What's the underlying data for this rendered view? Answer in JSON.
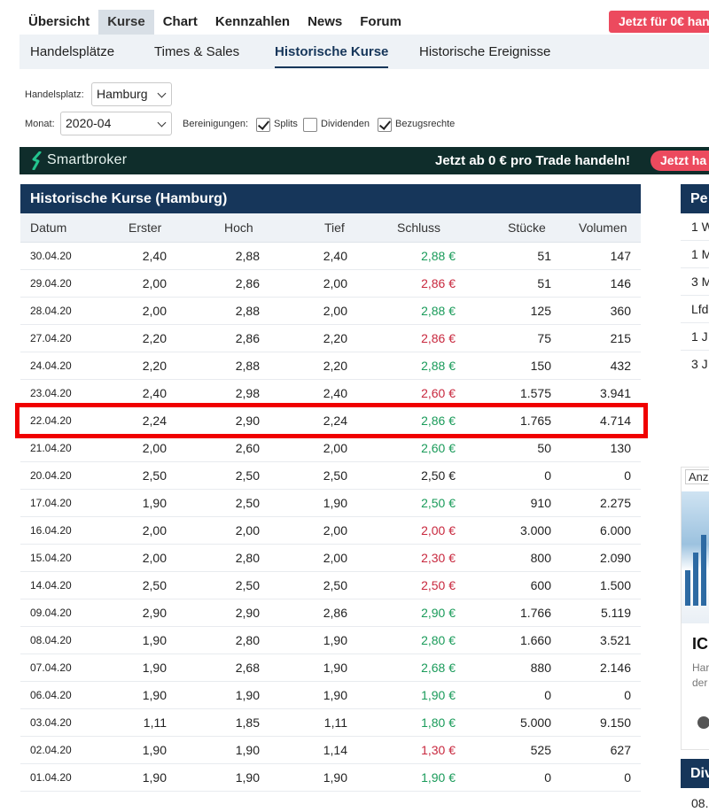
{
  "topnav": {
    "items": [
      {
        "label": "Übersicht"
      },
      {
        "label": "Kurse"
      },
      {
        "label": "Chart"
      },
      {
        "label": "Kennzahlen"
      },
      {
        "label": "News"
      },
      {
        "label": "Forum"
      }
    ],
    "active": "Kurse",
    "cta_label": "Jetzt für 0€ han"
  },
  "subnav": {
    "items": [
      {
        "label": "Handelsplätze"
      },
      {
        "label": "Times & Sales"
      },
      {
        "label": "Historische Kurse"
      },
      {
        "label": "Historische Ereignisse"
      }
    ],
    "active": "Historische Kurse"
  },
  "filters": {
    "handelsplatz_label": "Handelsplatz:",
    "handelsplatz_value": "Hamburg",
    "monat_label": "Monat:",
    "monat_value": "2020-04",
    "bereinigungen_label": "Bereinigungen:",
    "splits_label": "Splits",
    "splits_checked": true,
    "dividenden_label": "Dividenden",
    "dividenden_checked": false,
    "bezugsrechte_label": "Bezugsrechte",
    "bezugsrechte_checked": true
  },
  "banner": {
    "brand": "Smartbroker",
    "slogan": "Jetzt ab 0 € pro Trade handeln!",
    "button_label": "Jetzt ha"
  },
  "table": {
    "title": "Historische Kurse (Hamburg)",
    "columns": [
      "Datum",
      "Erster",
      "Hoch",
      "Tief",
      "Schluss",
      "Stücke",
      "Volumen"
    ],
    "rows": [
      {
        "date": "30.04.20",
        "open": "2,40",
        "high": "2,88",
        "low": "2,40",
        "close": "2,88 €",
        "trend": "up",
        "shares": "51",
        "volume": "147"
      },
      {
        "date": "29.04.20",
        "open": "2,00",
        "high": "2,86",
        "low": "2,00",
        "close": "2,86 €",
        "trend": "down",
        "shares": "51",
        "volume": "146"
      },
      {
        "date": "28.04.20",
        "open": "2,00",
        "high": "2,88",
        "low": "2,00",
        "close": "2,88 €",
        "trend": "up",
        "shares": "125",
        "volume": "360"
      },
      {
        "date": "27.04.20",
        "open": "2,20",
        "high": "2,86",
        "low": "2,20",
        "close": "2,86 €",
        "trend": "down",
        "shares": "75",
        "volume": "215"
      },
      {
        "date": "24.04.20",
        "open": "2,20",
        "high": "2,88",
        "low": "2,20",
        "close": "2,88 €",
        "trend": "up",
        "shares": "150",
        "volume": "432"
      },
      {
        "date": "23.04.20",
        "open": "2,40",
        "high": "2,98",
        "low": "2,40",
        "close": "2,60 €",
        "trend": "down",
        "shares": "1.575",
        "volume": "3.941"
      },
      {
        "date": "22.04.20",
        "open": "2,24",
        "high": "2,90",
        "low": "2,24",
        "close": "2,86 €",
        "trend": "up",
        "shares": "1.765",
        "volume": "4.714"
      },
      {
        "date": "21.04.20",
        "open": "2,00",
        "high": "2,60",
        "low": "2,00",
        "close": "2,60 €",
        "trend": "up",
        "shares": "50",
        "volume": "130"
      },
      {
        "date": "20.04.20",
        "open": "2,50",
        "high": "2,50",
        "low": "2,50",
        "close": "2,50 €",
        "trend": "flat",
        "shares": "0",
        "volume": "0"
      },
      {
        "date": "17.04.20",
        "open": "1,90",
        "high": "2,50",
        "low": "1,90",
        "close": "2,50 €",
        "trend": "up",
        "shares": "910",
        "volume": "2.275"
      },
      {
        "date": "16.04.20",
        "open": "2,00",
        "high": "2,00",
        "low": "2,00",
        "close": "2,00 €",
        "trend": "down",
        "shares": "3.000",
        "volume": "6.000"
      },
      {
        "date": "15.04.20",
        "open": "2,00",
        "high": "2,80",
        "low": "2,00",
        "close": "2,30 €",
        "trend": "down",
        "shares": "800",
        "volume": "2.090"
      },
      {
        "date": "14.04.20",
        "open": "2,50",
        "high": "2,50",
        "low": "2,50",
        "close": "2,50 €",
        "trend": "down",
        "shares": "600",
        "volume": "1.500"
      },
      {
        "date": "09.04.20",
        "open": "2,90",
        "high": "2,90",
        "low": "2,86",
        "close": "2,90 €",
        "trend": "up",
        "shares": "1.766",
        "volume": "5.119"
      },
      {
        "date": "08.04.20",
        "open": "1,90",
        "high": "2,80",
        "low": "1,90",
        "close": "2,80 €",
        "trend": "up",
        "shares": "1.660",
        "volume": "3.521"
      },
      {
        "date": "07.04.20",
        "open": "1,90",
        "high": "2,68",
        "low": "1,90",
        "close": "2,68 €",
        "trend": "up",
        "shares": "880",
        "volume": "2.146"
      },
      {
        "date": "06.04.20",
        "open": "1,90",
        "high": "1,90",
        "low": "1,90",
        "close": "1,90 €",
        "trend": "up",
        "shares": "0",
        "volume": "0"
      },
      {
        "date": "03.04.20",
        "open": "1,11",
        "high": "1,85",
        "low": "1,11",
        "close": "1,80 €",
        "trend": "up",
        "shares": "5.000",
        "volume": "9.150"
      },
      {
        "date": "02.04.20",
        "open": "1,90",
        "high": "1,90",
        "low": "1,14",
        "close": "1,30 €",
        "trend": "down",
        "shares": "525",
        "volume": "627"
      },
      {
        "date": "01.04.20",
        "open": "1,90",
        "high": "1,90",
        "low": "1,90",
        "close": "1,90 €",
        "trend": "up",
        "shares": "0",
        "volume": "0"
      }
    ],
    "highlighted_date": "22.04.20"
  },
  "sidebar": {
    "perf_title": "Pe",
    "perf_rows": [
      "1 W",
      "1 M",
      "3 M",
      "Lfd",
      "1 J",
      "3 J"
    ],
    "ad_tag": "Anz",
    "ad_heading": "IC",
    "ad_text_lines": [
      "Har",
      "der"
    ],
    "div_title": "Div",
    "div_date": "08."
  },
  "colors": {
    "navy": "#16365a",
    "up": "#1a9b5a",
    "down": "#c8283e",
    "accent_red": "#ec4a5e",
    "highlight": "#f00000"
  }
}
